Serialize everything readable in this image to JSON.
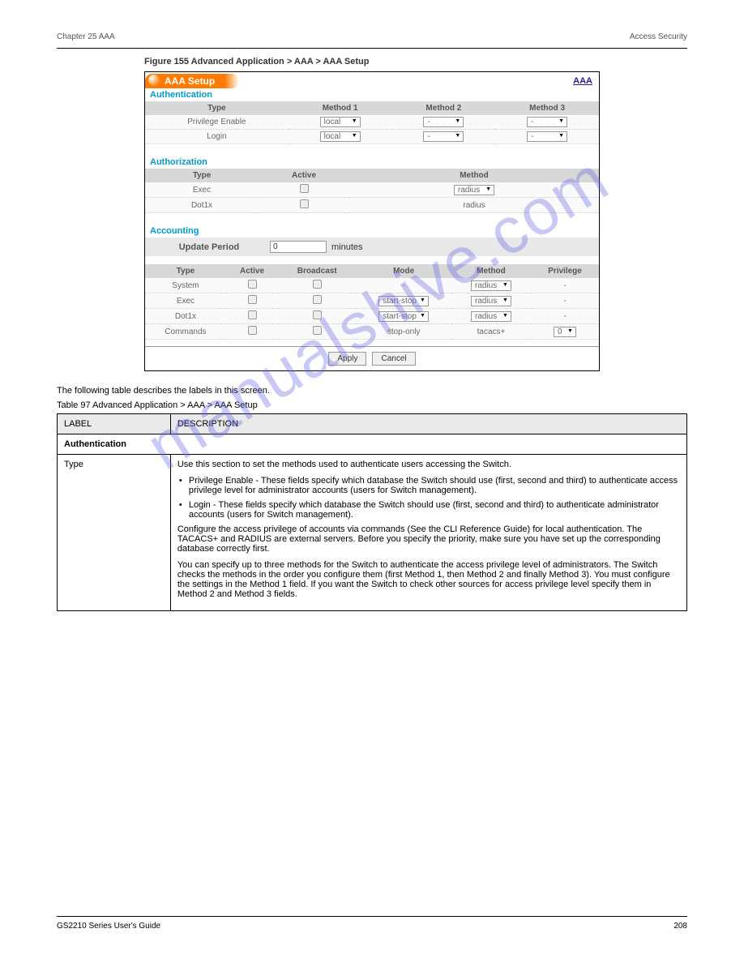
{
  "header": {
    "chapter": "Chapter 25 AAA",
    "section": "Access Security"
  },
  "figure": {
    "title": "Figure 155   Advanced Application > AAA > AAA Setup"
  },
  "watermark": "manualshive.com",
  "screenshot": {
    "badge": "AAA Setup",
    "link": "AAA",
    "auth": {
      "title": "Authentication",
      "cols": [
        "Type",
        "Method 1",
        "Method 2",
        "Method 3"
      ],
      "rows": [
        {
          "type": "Privilege Enable",
          "m1": "local",
          "m2": "-",
          "m3": "-"
        },
        {
          "type": "Login",
          "m1": "local",
          "m2": "-",
          "m3": "-"
        }
      ]
    },
    "authz": {
      "title": "Authorization",
      "cols": [
        "Type",
        "Active",
        "Method"
      ],
      "rows": [
        {
          "type": "Exec",
          "method": "radius"
        },
        {
          "type": "Dot1x",
          "method": "radius"
        }
      ]
    },
    "acct": {
      "title": "Accounting",
      "update_label": "Update Period",
      "update_value": "0",
      "update_unit": "minutes",
      "cols": [
        "Type",
        "Active",
        "Broadcast",
        "Mode",
        "Method",
        "Privilege"
      ],
      "rows": [
        {
          "type": "System",
          "mode": "-",
          "method": "radius",
          "priv": "-"
        },
        {
          "type": "Exec",
          "mode": "start-stop",
          "method": "radius",
          "priv": "-"
        },
        {
          "type": "Dot1x",
          "mode": "start-stop",
          "method": "radius",
          "priv": "-"
        },
        {
          "type": "Commands",
          "mode": "stop-only",
          "method": "tacacs+",
          "priv": "0"
        }
      ]
    },
    "buttons": {
      "apply": "Apply",
      "cancel": "Cancel"
    }
  },
  "doc": {
    "intro": "The following table describes the labels in this screen.",
    "table_title": "Table 97   Advanced Application > AAA > AAA Setup",
    "cols": [
      "LABEL",
      "DESCRIPTION"
    ],
    "rows": [
      {
        "label": "Authentication"
      },
      {
        "label": "Type",
        "desc": [
          "Use this section to set the methods used to authenticate users accessing the Switch.",
          "Privilege Enable - These fields specify which database the Switch should use (first, second and third) to authenticate access privilege level for administrator accounts (users for Switch management).",
          "Login - These fields specify which database the Switch should use (first, second and third) to authenticate administrator accounts (users for Switch management).",
          "Configure the access privilege of accounts via commands (See the CLI Reference Guide) for local authentication. The TACACS+ and RADIUS are external servers. Before you specify the priority, make sure you have set up the corresponding database correctly first.",
          "You can specify up to three methods for the Switch to authenticate the access privilege level of administrators. The Switch checks the methods in the order you configure them (first Method 1, then Method 2 and finally Method 3). You must configure the settings in the Method 1 field. If you want the Switch to check other sources for access privilege level specify them in Method 2 and Method 3 fields."
        ]
      }
    ]
  },
  "footer": {
    "left": "GS2210 Series User's Guide",
    "right": "208"
  }
}
